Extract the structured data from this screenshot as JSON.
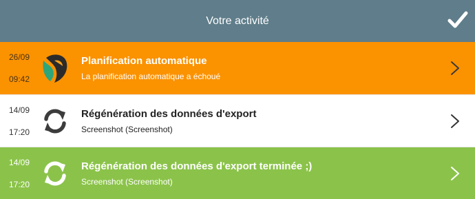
{
  "header": {
    "title": "Votre activité",
    "confirm_icon": "checkmark-icon"
  },
  "colors": {
    "header": "#5f7d8a",
    "error": "#fb9200",
    "neutral": "#ffffff",
    "success": "#8bc34a"
  },
  "items": [
    {
      "date": "26/09",
      "time": "09:42",
      "title": "Planification automatique",
      "subtitle": "La planification automatique a échoué",
      "icon": "planning-logo-icon",
      "status": "error"
    },
    {
      "date": "14/09",
      "time": "17:20",
      "title": "Régénération des données d'export",
      "subtitle": "Screenshot (Screenshot)",
      "icon": "refresh-icon",
      "status": "neutral"
    },
    {
      "date": "14/09",
      "time": "17:20",
      "title": "Régénération des données d'export terminée ;)",
      "subtitle": "Screenshot (Screenshot)",
      "icon": "refresh-icon",
      "status": "success"
    }
  ]
}
